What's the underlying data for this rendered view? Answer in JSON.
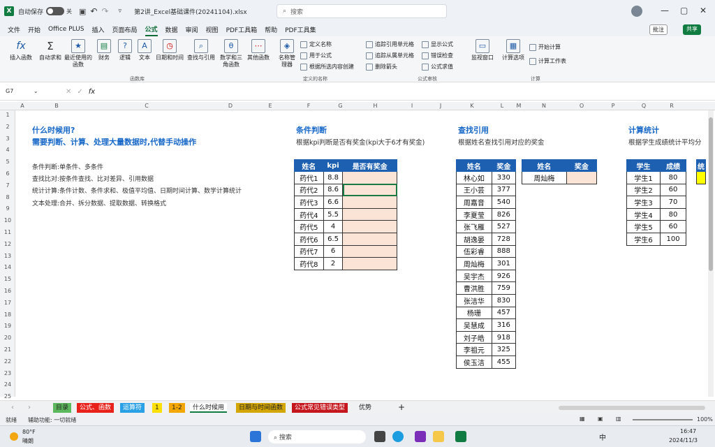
{
  "titlebar": {
    "autosave_label": "自动保存",
    "autosave_state": "关",
    "filename": "第2讲_Excel基础课件(20241104).xlsx",
    "search_placeholder": "搜索"
  },
  "menu": [
    "文件",
    "开始",
    "Office PLUS",
    "插入",
    "页面布局",
    "公式",
    "数据",
    "审阅",
    "视图",
    "PDF工具箱",
    "帮助",
    "PDF工具集"
  ],
  "active_menu": "公式",
  "comments_label": "批注",
  "share_label": "共享",
  "ribbon": {
    "function_library": [
      "插入函数",
      "自动求和",
      "最近使用的函数",
      "财务",
      "逻辑",
      "文本",
      "日期和时间",
      "查找与引用",
      "数学和三角函数",
      "其他函数"
    ],
    "function_library_label": "函数库",
    "name_manager": "名称管理器",
    "defined_names": [
      "定义名称",
      "用于公式",
      "根据所选内容创建"
    ],
    "defined_names_label": "定义的名称",
    "auditing": [
      "追踪引用单元格",
      "追踪从属单元格",
      "删除箭头",
      "显示公式",
      "错误检查",
      "公式求值"
    ],
    "auditing_label": "公式审核",
    "watch_window": "监视窗口",
    "calc_options": "计算选项",
    "calc": [
      "开始计算",
      "计算工作表"
    ],
    "calc_label": "计算"
  },
  "formula_bar": {
    "cell_ref": "G7",
    "content": ""
  },
  "columns": [
    "A",
    "B",
    "C",
    "D",
    "E",
    "F",
    "G",
    "H",
    "I",
    "J",
    "K",
    "L",
    "M",
    "N",
    "O",
    "P",
    "Q",
    "R"
  ],
  "rows": [
    "1",
    "2",
    "3",
    "4",
    "5",
    "6",
    "7",
    "8",
    "9",
    "10",
    "11",
    "12",
    "13",
    "14",
    "15",
    "16",
    "17",
    "18",
    "19",
    "20",
    "21",
    "22",
    "23",
    "24",
    "25"
  ],
  "section_left": {
    "title": "什么时候用?",
    "subtitle": "需要判断、计算、处理大量数据时,代替手动操作",
    "lines": [
      "条件判断:单条件、多条件",
      "查找比对:按条件查找、比对差异、引用数据",
      "统计计算:条件计数、条件求和、极值平均值、日期时间计算、数学计算统计",
      "文本处理:合并、拆分数据、提取数据、转换格式"
    ]
  },
  "section_cond": {
    "title": "条件判断",
    "desc": "根据kpi判断是否有奖金(kpi大于6才有奖金)",
    "headers": [
      "姓名",
      "kpi",
      "是否有奖金"
    ],
    "rows": [
      [
        "药代1",
        "8.8",
        ""
      ],
      [
        "药代2",
        "8.6",
        ""
      ],
      [
        "药代3",
        "6.6",
        ""
      ],
      [
        "药代4",
        "5.5",
        ""
      ],
      [
        "药代5",
        "4",
        ""
      ],
      [
        "药代6",
        "6.5",
        ""
      ],
      [
        "药代7",
        "6",
        ""
      ],
      [
        "药代8",
        "2",
        ""
      ]
    ]
  },
  "section_lookup": {
    "title": "查找引用",
    "desc": "根据姓名查找引用对应的奖金",
    "headers": [
      "姓名",
      "奖金"
    ],
    "rows": [
      [
        "林心如",
        "330"
      ],
      [
        "王小芸",
        "377"
      ],
      [
        "周嘉音",
        "540"
      ],
      [
        "李夏莹",
        "826"
      ],
      [
        "张飞雁",
        "527"
      ],
      [
        "胡逸晏",
        "728"
      ],
      [
        "伍彩睿",
        "888"
      ],
      [
        "周灿梅",
        "301"
      ],
      [
        "吴宇杰",
        "926"
      ],
      [
        "曹洪胜",
        "759"
      ],
      [
        "张洁华",
        "830"
      ],
      [
        "杨珊",
        "457"
      ],
      [
        "吴慧成",
        "316"
      ],
      [
        "刘子皓",
        "918"
      ],
      [
        "李祖元",
        "325"
      ],
      [
        "侯玉洁",
        "455"
      ]
    ],
    "query_headers": [
      "姓名",
      "奖金"
    ],
    "query_row": [
      "周灿梅",
      ""
    ]
  },
  "section_stats": {
    "title": "计算统计",
    "desc": "根据学生成绩统计平均分",
    "headers": [
      "学生",
      "成绩"
    ],
    "rows": [
      [
        "学生1",
        "80"
      ],
      [
        "学生2",
        "60"
      ],
      [
        "学生3",
        "70"
      ],
      [
        "学生4",
        "80"
      ],
      [
        "学生5",
        "60"
      ],
      [
        "学生6",
        "100"
      ]
    ],
    "extra_header": "统"
  },
  "sheet_tabs": [
    {
      "label": "目录",
      "color": "#5cb85c"
    },
    {
      "label": "公式、函数",
      "color": "#e8211b"
    },
    {
      "label": "运算符",
      "color": "#2aa0e6"
    },
    {
      "label": "1",
      "color": "#ffe000"
    },
    {
      "label": "1-2",
      "color": "#f4a700"
    },
    {
      "label": "什么时候用",
      "color": "#ffffff"
    },
    {
      "label": "日期与时间函数",
      "color": "#d4a600"
    },
    {
      "label": "公式常见错误类型",
      "color": "#c5161d"
    },
    {
      "label": "优势",
      "color": "#f0f1f3"
    }
  ],
  "status": {
    "ready": "就绪",
    "accessibility": "辅助功能: 一切就绪",
    "zoom": "100%"
  },
  "taskbar": {
    "weather_temp": "80°F",
    "weather_desc": "晴朗",
    "search": "搜索",
    "lang": "中",
    "time": "16:47",
    "date": "2024/11/3"
  }
}
